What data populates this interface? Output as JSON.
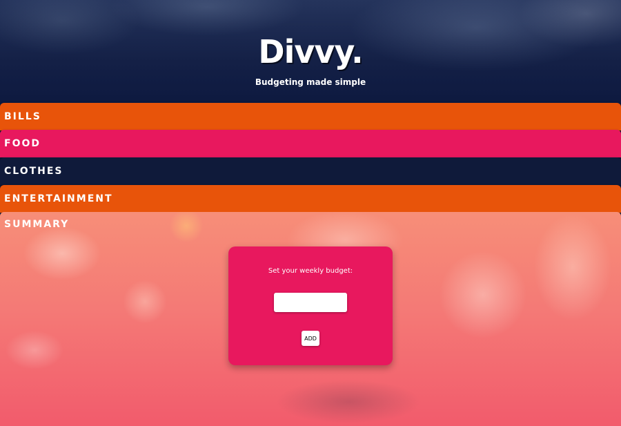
{
  "header": {
    "logo": "Divvy.",
    "tagline": "Budgeting made simple"
  },
  "categories": [
    {
      "label": "BILLS",
      "color": "#e8540a"
    },
    {
      "label": "FOOD",
      "color": "#e8185e"
    },
    {
      "label": "CLOTHES",
      "color": "#0f1a3a"
    },
    {
      "label": "ENTERTAINMENT",
      "color": "#e8540a"
    }
  ],
  "summary": {
    "label": "SUMMARY"
  },
  "budget_card": {
    "label": "Set your weekly budget:",
    "input_value": "",
    "add_label": "ADD",
    "color": "#e8185e"
  }
}
